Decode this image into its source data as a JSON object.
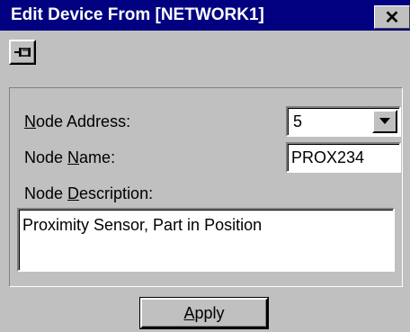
{
  "window": {
    "title": "Edit Device From [NETWORK1]",
    "close_glyph": "✕"
  },
  "toolbar": {
    "pin_icon": "pin-icon"
  },
  "form": {
    "node_address": {
      "label_prefix": "",
      "label_mnemonic": "N",
      "label_suffix": "ode Address:",
      "value": "5"
    },
    "node_name": {
      "label_prefix": "Node ",
      "label_mnemonic": "N",
      "label_suffix": "ame:",
      "value": "PROX234"
    },
    "node_description": {
      "label_prefix": "Node ",
      "label_mnemonic": "D",
      "label_suffix": "escription:",
      "value": "Proximity Sensor, Part in Position"
    }
  },
  "footer": {
    "apply_mnemonic": "A",
    "apply_suffix": "pply"
  },
  "colors": {
    "title_bar": "#000080",
    "face": "#c0c0c0",
    "field": "#ffffff"
  }
}
